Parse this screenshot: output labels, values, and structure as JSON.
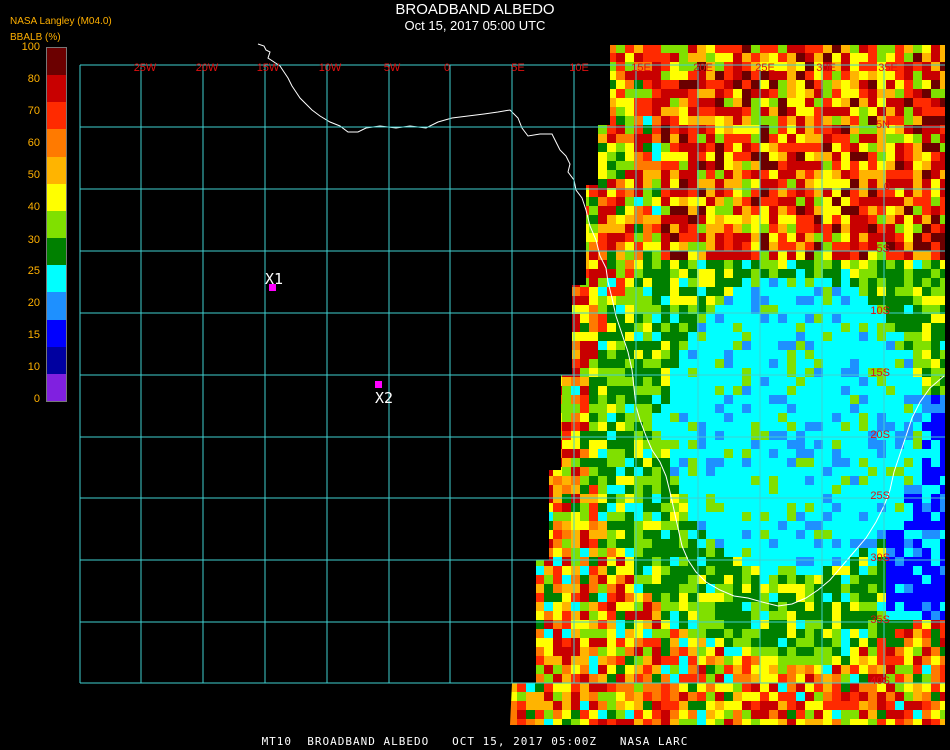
{
  "header": {
    "title": "BROADBAND ALBEDO",
    "subtitle": "Oct 15, 2017 05:00 UTC",
    "source": "NASA Langley (M04.0)",
    "variable": "BBALB (%)"
  },
  "colorbar": {
    "ticks": [
      "100",
      "80",
      "70",
      "60",
      "50",
      "40",
      "30",
      "25",
      "20",
      "15",
      "10",
      "0"
    ],
    "colors": [
      "#6b0000",
      "#c80000",
      "#ff2a00",
      "#ff7a00",
      "#ffb400",
      "#ffff00",
      "#80e000",
      "#008000",
      "#00ffff",
      "#1e90ff",
      "#0000ff",
      "#0000a0",
      "#8020e0"
    ]
  },
  "grid": {
    "color": "#40d0d0",
    "lon_labels": [
      "25W",
      "20W",
      "15W",
      "10W",
      "5W",
      "0",
      "5E",
      "10E",
      "15E",
      "20E",
      "25E",
      "30E",
      "35E"
    ],
    "lat_labels": [
      "5N",
      "0",
      "5S",
      "10S",
      "15S",
      "20S",
      "25S",
      "30S",
      "35S",
      "40S"
    ]
  },
  "markers": [
    {
      "label": "X1",
      "color": "#ff00ff"
    },
    {
      "label": "X2",
      "color": "#ff00ff"
    }
  ],
  "footer": "MT10  BROADBAND ALBEDO   OCT 15, 2017 05:00Z   NASA LARC"
}
